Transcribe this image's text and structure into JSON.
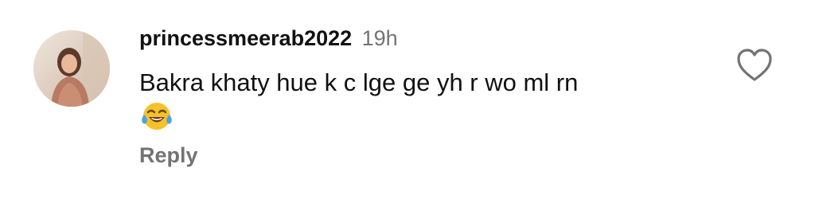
{
  "comment": {
    "username": "princessmeerab2022",
    "timestamp": "19h",
    "text": "Bakra khaty hue k c lge ge yh r wo ml rn",
    "emoji": "face-with-tears-of-joy",
    "reply_label": "Reply",
    "liked": false
  },
  "icons": {
    "like": "heart-outline-icon",
    "avatar": "profile-photo"
  },
  "colors": {
    "text_primary": "#111111",
    "text_secondary": "#737373",
    "emoji_yellow": "#f6c229",
    "emoji_tears": "#4aa3e8"
  }
}
